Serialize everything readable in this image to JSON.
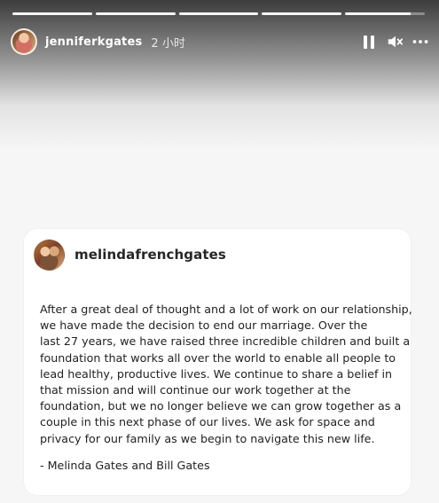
{
  "story": {
    "progress_segments": [
      {
        "state": "complete"
      },
      {
        "state": "complete"
      },
      {
        "state": "complete"
      },
      {
        "state": "complete"
      },
      {
        "state": "partial",
        "fill": 0.82
      }
    ],
    "header": {
      "username": "jenniferkgates",
      "time": "2 小时",
      "controls": {
        "pause_icon": "pause-icon",
        "mute_icon": "muted-speaker-icon",
        "more_icon": "more-options-icon"
      }
    }
  },
  "post": {
    "username": "melindafrenchgates",
    "statement_lines": [
      "After a great deal of thought and a lot of work on our relationship,",
      "we have made the decision to end our marriage. Over the",
      "last 27 years, we have raised three incredible children and built a",
      "foundation that works all over the world to enable all people to",
      "lead healthy, productive lives. We continue to share a belief in",
      "that mission and will continue our work together at the",
      "foundation, but we no longer believe we can grow together as a",
      "couple in this next phase of our lives. We ask for space and",
      "privacy for our family as we begin to navigate this new life."
    ],
    "signature": "- Melinda Gates and Bill Gates"
  },
  "colors": {
    "header_text": "#ffffff",
    "card_background": "#ffffff",
    "body_text": "#222222"
  }
}
